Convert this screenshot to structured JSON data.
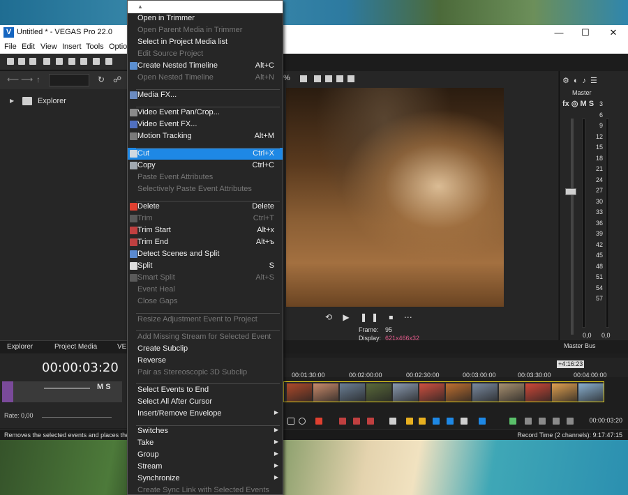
{
  "window": {
    "title": "Untitled * - VEGAS Pro 22.0",
    "logo_letter": "V",
    "controls": {
      "minimize": "—",
      "maximize": "☐",
      "close": "✕"
    }
  },
  "menubar": [
    "File",
    "Edit",
    "View",
    "Insert",
    "Tools",
    "Optio"
  ],
  "explorer": {
    "tree_item": "Explorer"
  },
  "panel_tabs": {
    "explorer_tab": "Explorer",
    "media_tab": "Project Media",
    "ve_tab": "VE"
  },
  "track": {
    "timecode": "00:00:03:20",
    "ms_label": "M  S",
    "rate": "Rate: 0,00"
  },
  "preview": {
    "zoom_suffix": "%",
    "frame_label": "Frame:",
    "frame_value": "95",
    "display_label": "Display:",
    "display_value": "621x466x32",
    "display_color": "#e05a8a",
    "transport": "⟲ ▶ ❚❚ ⏹ ⋯"
  },
  "master": {
    "label": "Master",
    "fx_row": "fx ◎ M  S",
    "scale": [
      "3",
      "6",
      "9",
      "12",
      "15",
      "18",
      "21",
      "24",
      "27",
      "30",
      "33",
      "36",
      "39",
      "42",
      "45",
      "48",
      "51",
      "54",
      "57"
    ],
    "bottom_left": "0,0",
    "bottom_right": "0,0",
    "tab": "Master Bus"
  },
  "timeline": {
    "end_badge": "+4:16:23",
    "ticks": [
      "00:01:30:00",
      "00:02:00:00",
      "00:02:30:00",
      "00:03:00:00",
      "00:03:30:00",
      "00:04:00:00"
    ],
    "cursor_time": "00:00:03:20",
    "thumb_colors": [
      "#b04a2a",
      "#c98a6a",
      "#6b7f95",
      "#5a6a3a",
      "#8a9ab0",
      "#d05040",
      "#c07030",
      "#7a8aa0",
      "#a89070",
      "#d04838",
      "#e0a050",
      "#8ab0d0"
    ]
  },
  "status": {
    "left": "Removes the selected events and places them",
    "right": "Record Time (2 channels): 9:17:47:15"
  },
  "context_menu": {
    "scroll_up": "▲",
    "items": [
      {
        "label": "Open in Trimmer",
        "shortcut": "",
        "enabled": true,
        "icon": ""
      },
      {
        "label": "Open Parent Media in Trimmer",
        "shortcut": "",
        "enabled": false,
        "icon": ""
      },
      {
        "label": "Select in Project Media list",
        "shortcut": "",
        "enabled": true,
        "icon": ""
      },
      {
        "label": "Edit Source Project",
        "shortcut": "",
        "enabled": false,
        "icon": ""
      },
      {
        "label": "Create Nested Timeline",
        "shortcut": "Alt+C",
        "enabled": true,
        "icon": "#5b8fd0"
      },
      {
        "label": "Open Nested Timeline",
        "shortcut": "Alt+N",
        "enabled": false,
        "icon": ""
      },
      {
        "label": "Media FX...",
        "shortcut": "",
        "enabled": true,
        "icon": "#6a8ac0"
      },
      {
        "label": "Video Event Pan/Crop...",
        "shortcut": "",
        "enabled": true,
        "icon": "#8a8a8a"
      },
      {
        "label": "Video Event FX...",
        "shortcut": "",
        "enabled": true,
        "icon": "#5070c0"
      },
      {
        "label": "Motion Tracking",
        "shortcut": "Alt+M",
        "enabled": true,
        "icon": "#7a7a7a"
      },
      {
        "label": "Cut",
        "shortcut": "Ctrl+X",
        "enabled": true,
        "icon": "#cfd8e0",
        "highlighted": true
      },
      {
        "label": "Copy",
        "shortcut": "Ctrl+C",
        "enabled": true,
        "icon": "#a0a8b0"
      },
      {
        "label": "Paste Event Attributes",
        "shortcut": "",
        "enabled": false,
        "icon": ""
      },
      {
        "label": "Selectively Paste Event Attributes",
        "shortcut": "",
        "enabled": false,
        "icon": ""
      },
      {
        "label": "Delete",
        "shortcut": "Delete",
        "enabled": true,
        "icon": "#e04030"
      },
      {
        "label": "Trim",
        "shortcut": "Ctrl+T",
        "enabled": false,
        "icon": "#5a5a5a"
      },
      {
        "label": "Trim Start",
        "shortcut": "Alt+x",
        "enabled": true,
        "icon": "#c04040"
      },
      {
        "label": "Trim End",
        "shortcut": "Alt+ъ",
        "enabled": true,
        "icon": "#c04040"
      },
      {
        "label": "Detect Scenes and Split",
        "shortcut": "",
        "enabled": true,
        "icon": "#5a8ad0"
      },
      {
        "label": "Split",
        "shortcut": "S",
        "enabled": true,
        "icon": "#dddddd"
      },
      {
        "label": "Smart Split",
        "shortcut": "Alt+S",
        "enabled": false,
        "icon": "#5a5a5a"
      },
      {
        "label": "Event Heal",
        "shortcut": "",
        "enabled": false,
        "icon": ""
      },
      {
        "label": "Close Gaps",
        "shortcut": "",
        "enabled": false,
        "icon": ""
      },
      {
        "label": "Resize Adjustment Event to Project",
        "shortcut": "",
        "enabled": false,
        "icon": ""
      },
      {
        "label": "Add Missing Stream for Selected Event",
        "shortcut": "",
        "enabled": false,
        "icon": ""
      },
      {
        "label": "Create Subclip",
        "shortcut": "",
        "enabled": true,
        "icon": ""
      },
      {
        "label": "Reverse",
        "shortcut": "",
        "enabled": true,
        "icon": ""
      },
      {
        "label": "Pair as Stereoscopic 3D Subclip",
        "shortcut": "",
        "enabled": false,
        "icon": ""
      },
      {
        "label": "Select Events to End",
        "shortcut": "",
        "enabled": true,
        "icon": ""
      },
      {
        "label": "Select All After Cursor",
        "shortcut": "",
        "enabled": true,
        "icon": ""
      },
      {
        "label": "Insert/Remove Envelope",
        "shortcut": "",
        "enabled": true,
        "icon": "",
        "submenu": true
      },
      {
        "label": "Switches",
        "shortcut": "",
        "enabled": true,
        "icon": "",
        "submenu": true
      },
      {
        "label": "Take",
        "shortcut": "",
        "enabled": true,
        "icon": "",
        "submenu": true
      },
      {
        "label": "Group",
        "shortcut": "",
        "enabled": true,
        "icon": "",
        "submenu": true
      },
      {
        "label": "Stream",
        "shortcut": "",
        "enabled": true,
        "icon": "",
        "submenu": true
      },
      {
        "label": "Synchronize",
        "shortcut": "",
        "enabled": true,
        "icon": "",
        "submenu": true
      },
      {
        "label": "Create Sync Link with Selected Events",
        "shortcut": "",
        "enabled": false,
        "icon": ""
      }
    ],
    "submenu_arrow": "▶"
  }
}
